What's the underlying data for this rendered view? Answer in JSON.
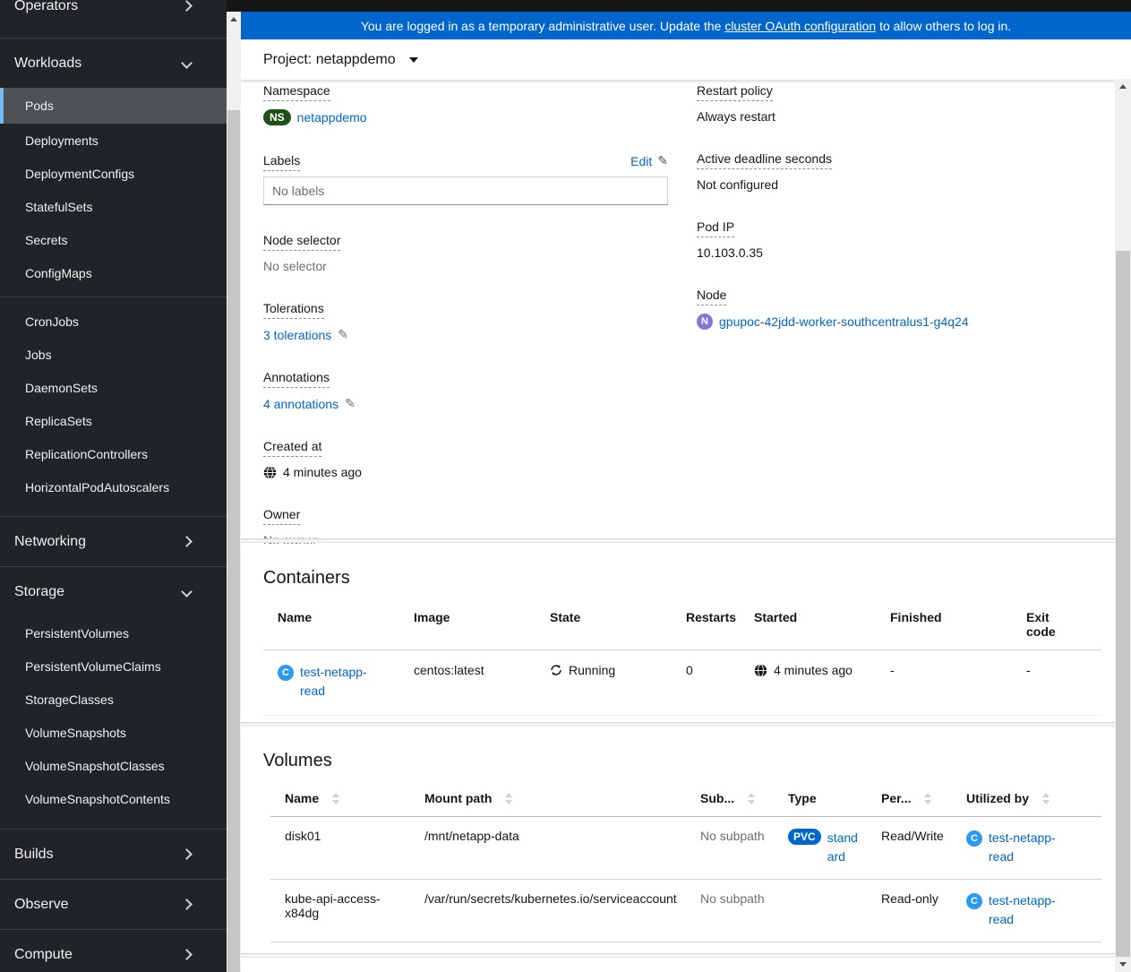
{
  "banner": {
    "prefix": "You are logged in as a temporary administrative user. Update the ",
    "link_text": "cluster OAuth configuration",
    "suffix": " to allow others to log in."
  },
  "project_bar": {
    "label": "Project: netappdemo"
  },
  "sidebar": {
    "selected_item": "Pods",
    "groups": [
      {
        "label": "Operators"
      },
      {
        "label": "Workloads",
        "items": [
          "Pods",
          "Deployments",
          "DeploymentConfigs",
          "StatefulSets",
          "Secrets",
          "ConfigMaps",
          "CronJobs",
          "Jobs",
          "DaemonSets",
          "ReplicaSets",
          "ReplicationControllers",
          "HorizontalPodAutoscalers"
        ]
      },
      {
        "label": "Networking"
      },
      {
        "label": "Storage",
        "items": [
          "PersistentVolumes",
          "PersistentVolumeClaims",
          "StorageClasses",
          "VolumeSnapshots",
          "VolumeSnapshotClasses",
          "VolumeSnapshotContents"
        ]
      },
      {
        "label": "Builds"
      },
      {
        "label": "Observe"
      },
      {
        "label": "Compute"
      }
    ]
  },
  "details": {
    "left": {
      "namespace_label": "Namespace",
      "namespace_badge": "NS",
      "namespace_value": "netappdemo",
      "labels_label": "Labels",
      "edit_label": "Edit",
      "labels_placeholder": "No labels",
      "node_selector_label": "Node selector",
      "node_selector_value": "No selector",
      "tolerations_label": "Tolerations",
      "tolerations_value": "3 tolerations",
      "annotations_label": "Annotations",
      "annotations_value": "4 annotations",
      "created_label": "Created at",
      "created_value": "4 minutes ago",
      "owner_label": "Owner",
      "owner_value": "No owner"
    },
    "right": {
      "restart_policy_label": "Restart policy",
      "restart_policy_value": "Always restart",
      "active_deadline_label": "Active deadline seconds",
      "active_deadline_value": "Not configured",
      "pod_ip_label": "Pod IP",
      "pod_ip_value": "10.103.0.35",
      "node_label": "Node",
      "node_badge": "N",
      "node_value": "gpupoc-42jdd-worker-southcentralus1-g4q24"
    }
  },
  "containers": {
    "title": "Containers",
    "headers": [
      "Name",
      "Image",
      "State",
      "Restarts",
      "Started",
      "Finished",
      "Exit code"
    ],
    "row": {
      "badge": "C",
      "name": "test-netapp-read",
      "image": "centos:latest",
      "state": "Running",
      "restarts": "0",
      "started": "4 minutes ago",
      "finished": "-",
      "exit_code": "-"
    }
  },
  "volumes": {
    "title": "Volumes",
    "headers": [
      "Name",
      "Mount path",
      "Sub...",
      "Type",
      "Per...",
      "Utilized by"
    ],
    "rows": [
      {
        "name": "disk01",
        "mount_path": "/mnt/netapp-data",
        "subpath": "No subpath",
        "type_badge": "PVC",
        "type_value": "standard",
        "permissions": "Read/Write",
        "utilized_badge": "C",
        "utilized_by": "test-netapp-read"
      },
      {
        "name": "kube-api-access-x84dg",
        "mount_path": "/var/run/secrets/kubernetes.io/serviceaccount",
        "subpath": "No subpath",
        "type_badge": "",
        "type_value": "",
        "permissions": "Read-only",
        "utilized_badge": "C",
        "utilized_by": "test-netapp-read"
      }
    ]
  },
  "icons": {
    "pencil": "✎"
  },
  "colors": {
    "banner_blue": "#0066cc",
    "link_blue": "#0066cc",
    "sidebar_bg": "#212427",
    "selected_item_bg": "#4f5255",
    "selected_item_border": "#73bcf7",
    "namespace_badge_green": "#1e4f18",
    "node_badge_purple": "#8476d1",
    "container_badge_blue": "#2b9af3",
    "pvc_badge_blue": "#0066cc"
  }
}
